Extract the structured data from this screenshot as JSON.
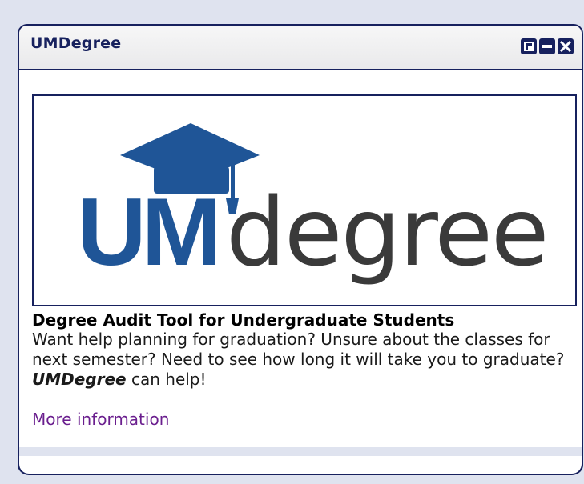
{
  "window": {
    "title": "UMDegree",
    "controls": [
      {
        "name": "restore-icon"
      },
      {
        "name": "minimize-icon"
      },
      {
        "name": "close-icon"
      }
    ]
  },
  "logo": {
    "letters_primary": "UM",
    "letters_secondary": "degree",
    "brand_blue": "#1f5597",
    "text_gray": "#3a3a3a"
  },
  "content": {
    "heading": "Degree Audit Tool for Undergraduate Students",
    "description_part1": "Want help planning for graduation?  Unsure about the classes for next semester?  Need to see how long it will take you to graduate? ",
    "description_emphasis": "UMDegree",
    "description_part2": " can help!",
    "more_link": "More information"
  },
  "colors": {
    "border": "#17215e",
    "background": "#dfe3ef",
    "link": "#6a1e8e"
  }
}
